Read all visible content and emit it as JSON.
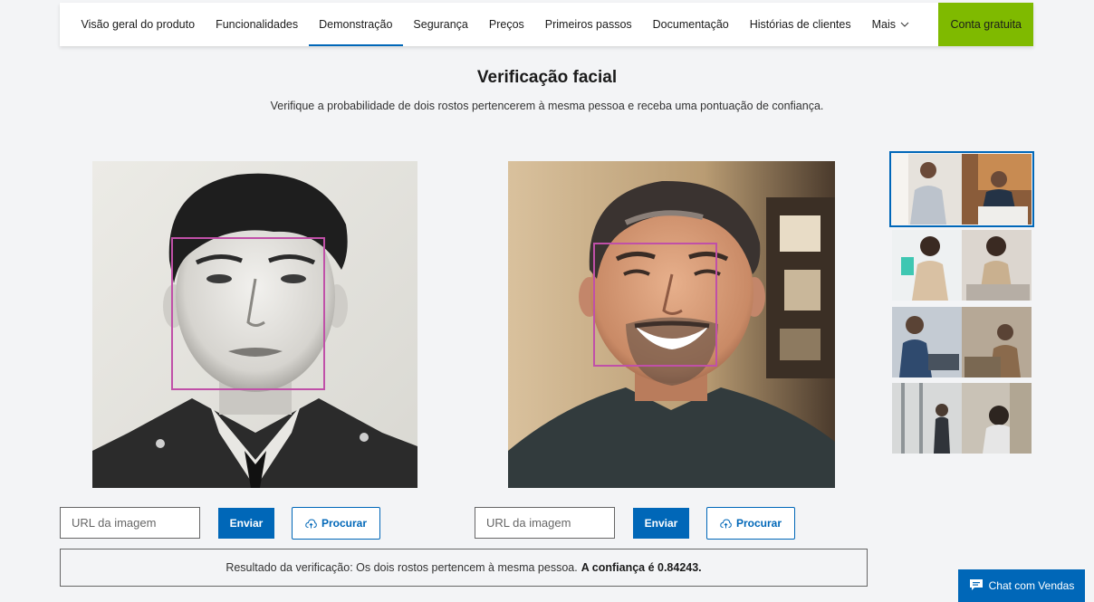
{
  "nav": {
    "items": [
      {
        "label": "Visão geral do produto"
      },
      {
        "label": "Funcionalidades"
      },
      {
        "label": "Demonstração"
      },
      {
        "label": "Segurança"
      },
      {
        "label": "Preços"
      },
      {
        "label": "Primeiros passos"
      },
      {
        "label": "Documentação"
      },
      {
        "label": "Histórias de clientes"
      },
      {
        "label": "Mais"
      }
    ],
    "active": "Demonstração",
    "cta_label": "Conta gratuita"
  },
  "page": {
    "title": "Verificação facial",
    "subtitle": "Verifique a probabilidade de dois rostos pertencerem à mesma pessoa e receba uma pontuação de confiança."
  },
  "left": {
    "url_placeholder": "URL da imagem",
    "send_label": "Enviar",
    "browse_label": "Procurar"
  },
  "right": {
    "url_placeholder": "URL da imagem",
    "send_label": "Enviar",
    "browse_label": "Procurar"
  },
  "result": {
    "prefix": "Resultado da verificação: Os dois rostos pertencem à mesma pessoa.",
    "confidence": "A confiança é 0.84243."
  },
  "chat": {
    "label": "Chat com Vendas",
    "icon": "chat-icon"
  },
  "colors": {
    "accent": "#0067b8",
    "cta": "#7fba00",
    "face_box": "#c050a8"
  }
}
